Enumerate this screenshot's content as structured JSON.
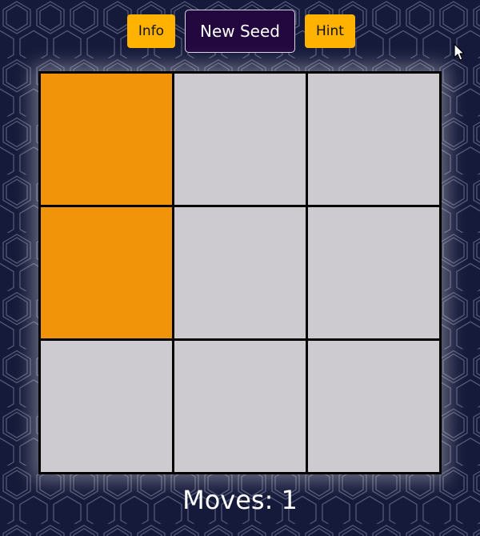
{
  "toolbar": {
    "info_label": "Info",
    "new_seed_label": "New Seed",
    "hint_label": "Hint"
  },
  "board": {
    "rows": 3,
    "cols": 3,
    "lit_color": "#f19409",
    "unlit_color": "#cdcbd0",
    "cells": [
      [
        true,
        false,
        false
      ],
      [
        true,
        false,
        false
      ],
      [
        false,
        false,
        false
      ]
    ]
  },
  "status": {
    "moves_prefix": "Moves: ",
    "moves_count": "1"
  },
  "colors": {
    "background": "#151a3a",
    "button_accent": "#ffb300",
    "seed_button": "#23083f"
  }
}
